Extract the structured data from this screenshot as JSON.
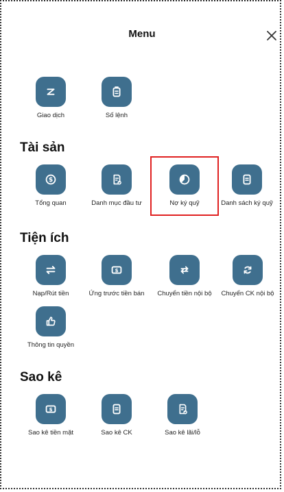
{
  "header": {
    "title": "Menu",
    "close_icon": "close-icon"
  },
  "quick": [
    {
      "label": "Giao dịch",
      "icon": "z-icon"
    },
    {
      "label": "Số lệnh",
      "icon": "clipboard-icon"
    }
  ],
  "sections": [
    {
      "title": "Tài sản",
      "items": [
        {
          "label": "Tổng quan",
          "icon": "dollar-coin-icon"
        },
        {
          "label": "Danh mục đầu tư",
          "icon": "document-check-icon"
        },
        {
          "label": "Nợ ký quỹ",
          "icon": "clock-pie-icon"
        },
        {
          "label": "Danh sách ký quỹ",
          "icon": "document-icon"
        }
      ]
    },
    {
      "title": "Tiện ích",
      "items": [
        {
          "label": "Nạp/Rút tiền",
          "icon": "swap-arrows-icon"
        },
        {
          "label": "Ứng trước tiền bán",
          "icon": "banknote-icon"
        },
        {
          "label": "Chuyển tiền nội bộ",
          "icon": "transfer-arrows-icon"
        },
        {
          "label": "Chuyển CK nội bộ",
          "icon": "refresh-icon"
        },
        {
          "label": "Thông tin quyền",
          "icon": "thumbs-up-icon"
        }
      ]
    },
    {
      "title": "Sao kê",
      "items": [
        {
          "label": "Sao kê tiền mặt",
          "icon": "banknote-icon"
        },
        {
          "label": "Sao kê CK",
          "icon": "document-icon"
        },
        {
          "label": "Sao kê lãi/lỗ",
          "icon": "document-check-icon"
        }
      ]
    }
  ],
  "colors": {
    "tile": "#3f6f8e",
    "highlight": "#e02020"
  }
}
